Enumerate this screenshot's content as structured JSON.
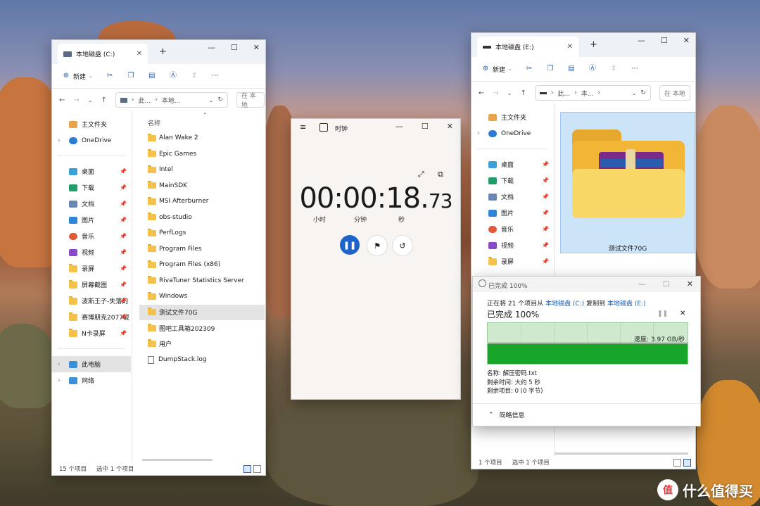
{
  "explorer_left": {
    "tab_title": "本地磁盘 (C:)",
    "toolbar": {
      "new_label": "新建"
    },
    "address": {
      "crumb1": "此...",
      "crumb2": "本地...",
      "search_placeholder": "在 本地"
    },
    "nav": [
      {
        "label": "主文件夹",
        "icon": "home-icon"
      },
      {
        "label": "OneDrive",
        "icon": "cloud-icon"
      },
      {
        "label": "桌面",
        "icon": "desktop-icon"
      },
      {
        "label": "下载",
        "icon": "download-icon"
      },
      {
        "label": "文档",
        "icon": "document-icon"
      },
      {
        "label": "图片",
        "icon": "picture-icon"
      },
      {
        "label": "音乐",
        "icon": "music-icon"
      },
      {
        "label": "视频",
        "icon": "video-icon"
      },
      {
        "label": "录屏",
        "icon": "folder-icon"
      },
      {
        "label": "屏幕截图",
        "icon": "folder-icon"
      },
      {
        "label": "波斯王子-失落的",
        "icon": "folder-icon"
      },
      {
        "label": "赛博朋克2077截",
        "icon": "folder-icon"
      },
      {
        "label": "N卡录屏",
        "icon": "folder-icon"
      },
      {
        "label": "此电脑",
        "icon": "pc-icon"
      },
      {
        "label": "网络",
        "icon": "network-icon"
      }
    ],
    "column_header": "名称",
    "files": [
      "Alan Wake 2",
      "Epic Games",
      "Intel",
      "MainSDK",
      "MSI Afterburner",
      "obs-studio",
      "PerfLogs",
      "Program Files",
      "Program Files (x86)",
      "RivaTuner Statistics Server",
      "Windows",
      "测试文件70G",
      "图吧工具箱202309",
      "用户",
      "DumpStack.log"
    ],
    "status": {
      "count": "15 个项目",
      "selected": "选中 1 个项目"
    }
  },
  "clock": {
    "title": "时钟",
    "time_main": "00:00:18.",
    "time_ms": "73",
    "units": {
      "h": "小时",
      "m": "分钟",
      "s": "秒"
    }
  },
  "explorer_right": {
    "tab_title": "本地磁盘 (E:)",
    "toolbar": {
      "new_label": "新建"
    },
    "address": {
      "crumb1": "此...",
      "crumb2": "本...",
      "search_placeholder": "在 本地"
    },
    "nav": [
      {
        "label": "主文件夹",
        "icon": "home-icon"
      },
      {
        "label": "OneDrive",
        "icon": "cloud-icon"
      },
      {
        "label": "桌面",
        "icon": "desktop-icon"
      },
      {
        "label": "下载",
        "icon": "download-icon"
      },
      {
        "label": "文档",
        "icon": "document-icon"
      },
      {
        "label": "图片",
        "icon": "picture-icon"
      },
      {
        "label": "音乐",
        "icon": "music-icon"
      },
      {
        "label": "视频",
        "icon": "video-icon"
      },
      {
        "label": "录屏",
        "icon": "folder-icon"
      }
    ],
    "tile_label": "测试文件70G",
    "status": {
      "count": "1 个项目",
      "selected": "选中 1 个项目"
    }
  },
  "copy_dialog": {
    "title": "已完成 100%",
    "line1_prefix": "正在将 21 个项目从",
    "src": "本地磁盘 (C:)",
    "line1_mid": "复制到",
    "dst": "本地磁盘 (E:)",
    "progress_text": "已完成 100%",
    "progress": 1.0,
    "speed": "速度: 3.97 GB/秒",
    "name_line": "名称: 解压密码.txt",
    "time_line": "剩余时间: 大约 5 秒",
    "items_line": "剩余项目: 0 (0 字节)",
    "details_label": "简略信息"
  },
  "watermark": {
    "text": "什么值得买"
  }
}
